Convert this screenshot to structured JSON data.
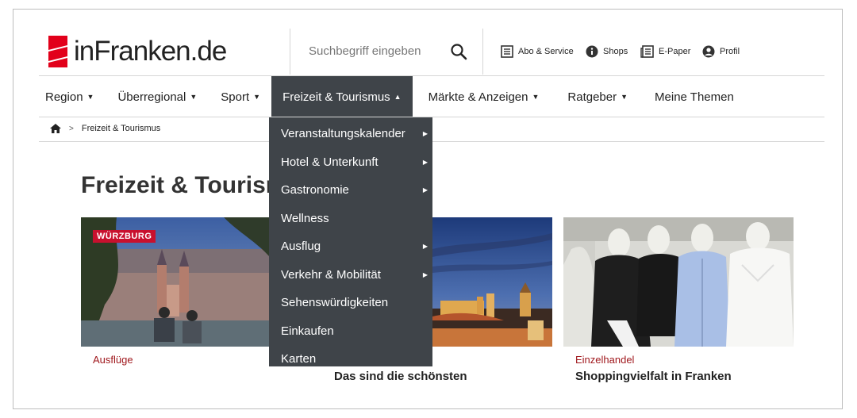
{
  "logo": {
    "text": "inFranken.de"
  },
  "search": {
    "placeholder": "Suchbegriff eingeben"
  },
  "utility": [
    {
      "label": "Abo & Service",
      "icon": "newspaper-list-icon"
    },
    {
      "label": "Shops",
      "icon": "info-icon"
    },
    {
      "label": "E-Paper",
      "icon": "epaper-icon"
    },
    {
      "label": "Profil",
      "icon": "user-icon"
    }
  ],
  "nav": {
    "items": [
      {
        "label": "Region",
        "caret": "▼"
      },
      {
        "label": "Überregional",
        "caret": "▼"
      },
      {
        "label": "Sport",
        "caret": "▼"
      },
      {
        "label": "Freizeit & Tourismus",
        "caret": "▲"
      },
      {
        "label": "Märkte & Anzeigen",
        "caret": "▼"
      },
      {
        "label": "Ratgeber",
        "caret": "▼"
      },
      {
        "label": "Meine Themen",
        "caret": ""
      }
    ]
  },
  "breadcrumb": {
    "separator": ">",
    "current": "Freizeit & Tourismus"
  },
  "dropdown": {
    "items": [
      {
        "label": "Veranstaltungskalender",
        "arrow": "▶"
      },
      {
        "label": "Hotel & Unterkunft",
        "arrow": "▶"
      },
      {
        "label": "Gastronomie",
        "arrow": "▶"
      },
      {
        "label": "Wellness",
        "arrow": ""
      },
      {
        "label": "Ausflug",
        "arrow": "▶"
      },
      {
        "label": "Verkehr & Mobilität",
        "arrow": "▶"
      },
      {
        "label": "Sehenswürdigkeiten",
        "arrow": ""
      },
      {
        "label": "Einkaufen",
        "arrow": ""
      },
      {
        "label": "Karten",
        "arrow": ""
      }
    ]
  },
  "main": {
    "title": "Freizeit & Tourismus"
  },
  "cards": [
    {
      "badge": "WÜRZBURG",
      "kicker": "Ausflüge",
      "headline": ""
    },
    {
      "badge": "",
      "kicker": "",
      "headline": "Das sind die schönsten"
    },
    {
      "badge": "",
      "kicker": "Einzelhandel",
      "headline": "Shoppingvielfalt in Franken"
    }
  ],
  "colors": {
    "accent": "#c8102e",
    "nav_active": "#3f4449",
    "kicker": "#a0191e"
  }
}
